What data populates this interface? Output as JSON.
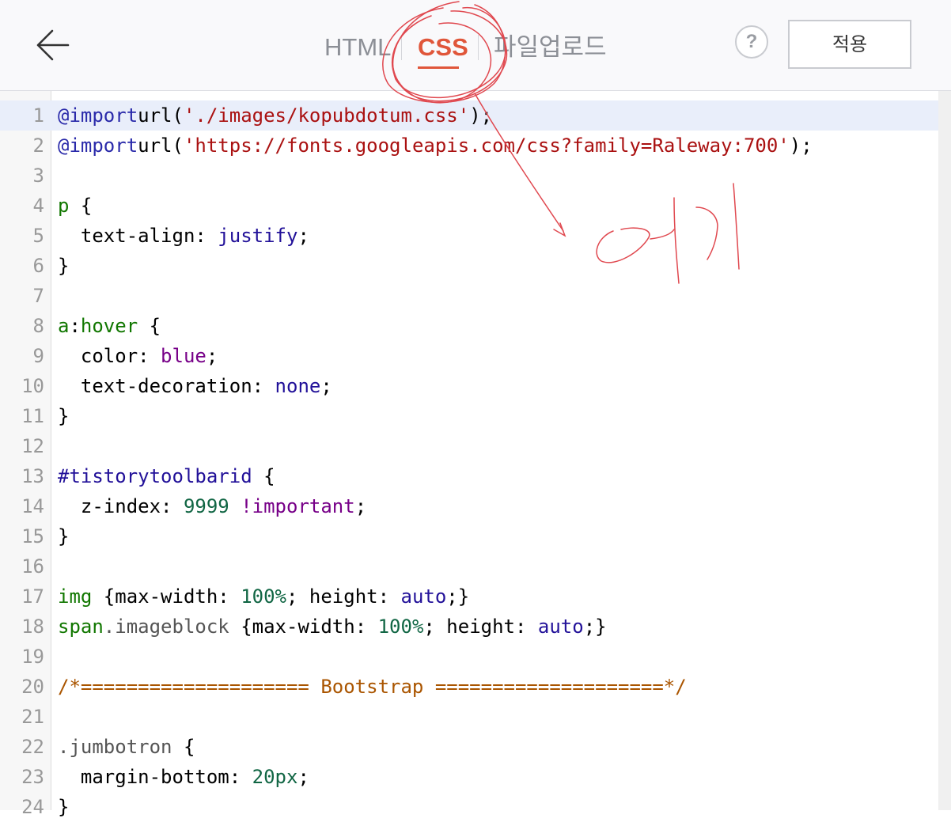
{
  "header": {
    "tabs": [
      {
        "label": "HTML",
        "active": false
      },
      {
        "label": "CSS",
        "active": true
      },
      {
        "label": "파일업로드",
        "active": false
      }
    ],
    "help_label": "?",
    "apply_label": "적용"
  },
  "annotation": {
    "text": "여기"
  },
  "colors": {
    "accent": "#e0563a",
    "muted": "#8c8f96"
  },
  "editor": {
    "lines": [
      {
        "n": "1",
        "parts": [
          [
            "kw",
            "@import"
          ],
          [
            "",
            "url("
          ],
          [
            "str",
            "'./images/kopubdotum.css'"
          ],
          [
            "",
            ");"
          ]
        ]
      },
      {
        "n": "2",
        "parts": [
          [
            "kw",
            "@import"
          ],
          [
            "",
            "url("
          ],
          [
            "str",
            "'https://fonts.googleapis.com/css?family=Raleway:700'"
          ],
          [
            "",
            ");"
          ]
        ]
      },
      {
        "n": "3",
        "parts": []
      },
      {
        "n": "4",
        "parts": [
          [
            "tag",
            "p"
          ],
          [
            "",
            " {"
          ]
        ]
      },
      {
        "n": "5",
        "parts": [
          [
            "",
            "  text-align: "
          ],
          [
            "atom",
            "justify"
          ],
          [
            "",
            ";"
          ]
        ]
      },
      {
        "n": "6",
        "parts": [
          [
            "",
            "}"
          ]
        ]
      },
      {
        "n": "7",
        "parts": []
      },
      {
        "n": "8",
        "parts": [
          [
            "tag",
            "a"
          ],
          [
            "",
            ":"
          ],
          [
            "tag",
            "hover"
          ],
          [
            "",
            " {"
          ]
        ]
      },
      {
        "n": "9",
        "parts": [
          [
            "",
            "  color: "
          ],
          [
            "kwd",
            "blue"
          ],
          [
            "",
            ";"
          ]
        ]
      },
      {
        "n": "10",
        "parts": [
          [
            "",
            "  text-decoration: "
          ],
          [
            "atom",
            "none"
          ],
          [
            "",
            ";"
          ]
        ]
      },
      {
        "n": "11",
        "parts": [
          [
            "",
            "}"
          ]
        ]
      },
      {
        "n": "12",
        "parts": []
      },
      {
        "n": "13",
        "parts": [
          [
            "atom",
            "#tistorytoolbarid"
          ],
          [
            "",
            " {"
          ]
        ]
      },
      {
        "n": "14",
        "parts": [
          [
            "",
            "  z-index: "
          ],
          [
            "num",
            "9999"
          ],
          [
            "",
            " "
          ],
          [
            "kwd",
            "!important"
          ],
          [
            "",
            ";"
          ]
        ]
      },
      {
        "n": "15",
        "parts": [
          [
            "",
            "}"
          ]
        ]
      },
      {
        "n": "16",
        "parts": []
      },
      {
        "n": "17",
        "parts": [
          [
            "tag",
            "img"
          ],
          [
            "",
            " {max-width: "
          ],
          [
            "num",
            "100%"
          ],
          [
            "",
            "; height: "
          ],
          [
            "atom",
            "auto"
          ],
          [
            "",
            ";}"
          ]
        ]
      },
      {
        "n": "18",
        "parts": [
          [
            "tag",
            "span"
          ],
          [
            "qual",
            ".imageblock"
          ],
          [
            "",
            " {max-width: "
          ],
          [
            "num",
            "100%"
          ],
          [
            "",
            "; height: "
          ],
          [
            "atom",
            "auto"
          ],
          [
            "",
            ";}"
          ]
        ]
      },
      {
        "n": "19",
        "parts": []
      },
      {
        "n": "20",
        "parts": [
          [
            "cmt",
            "/*==================== Bootstrap ====================*/"
          ]
        ]
      },
      {
        "n": "21",
        "parts": []
      },
      {
        "n": "22",
        "parts": [
          [
            "qual",
            ".jumbotron"
          ],
          [
            "",
            " {"
          ]
        ]
      },
      {
        "n": "23",
        "parts": [
          [
            "",
            "  margin-bottom: "
          ],
          [
            "num",
            "20px"
          ],
          [
            "",
            ";"
          ]
        ]
      },
      {
        "n": "24",
        "parts": [
          [
            "",
            "}"
          ]
        ]
      }
    ]
  }
}
